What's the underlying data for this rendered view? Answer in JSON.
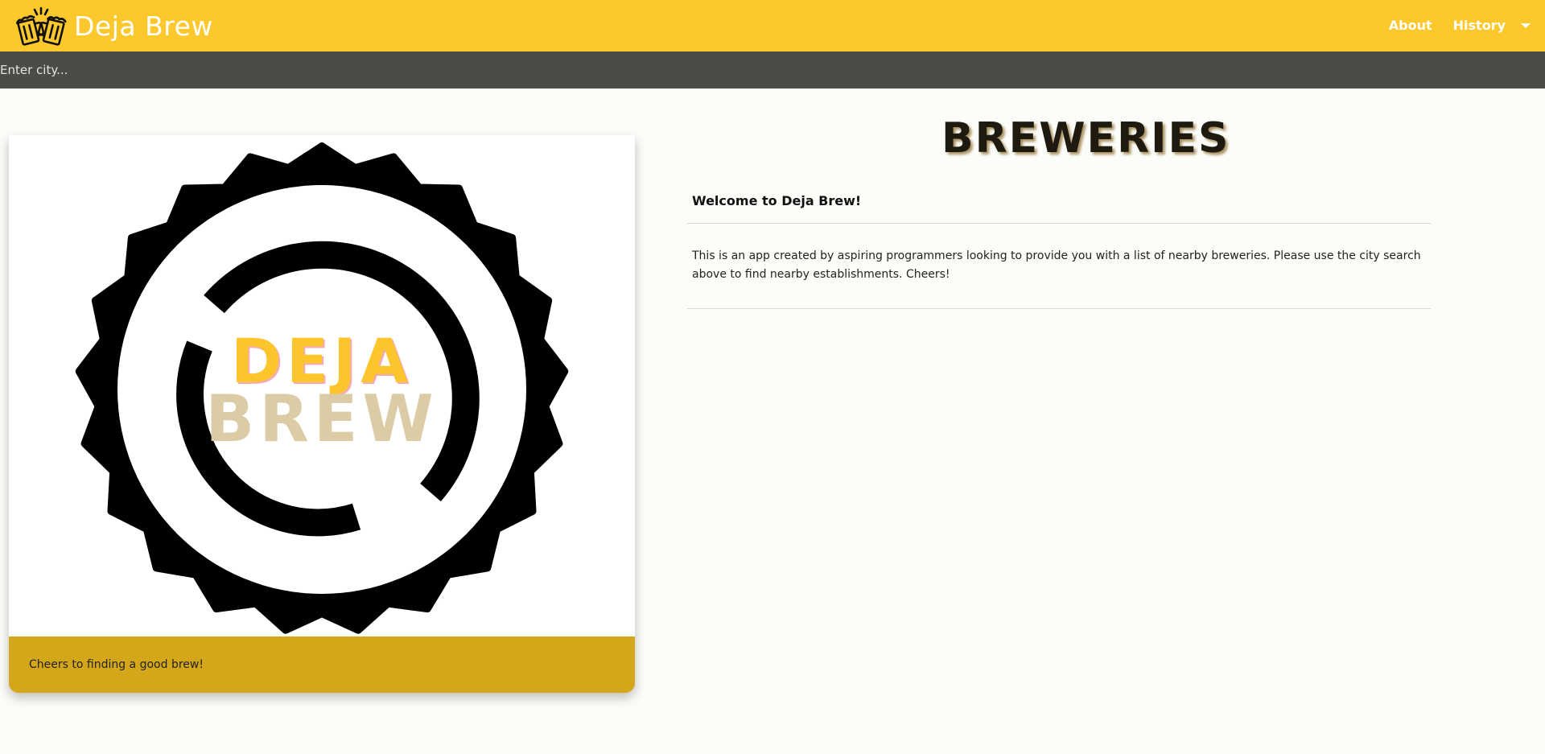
{
  "navbar": {
    "brand": "Deja Brew",
    "links": {
      "about": "About",
      "history": "History"
    },
    "colors": {
      "background": "#fdc82b",
      "text": "#ffffff"
    }
  },
  "search": {
    "placeholder": "Enter city...",
    "value": ""
  },
  "card": {
    "logo_text_top": "DEJA",
    "logo_text_bottom": "BREW",
    "caption": "Cheers to finding a good brew!",
    "footer_color": "#d4a71b"
  },
  "main": {
    "title": "BREWERIES",
    "welcome": "Welcome to Deja Brew!",
    "intro": "This is an app created by aspiring programmers looking to provide you with a list of nearby breweries. Please use the city search above to find nearby establishments. Cheers!"
  },
  "icons": {
    "brand": "beer-mugs-cheers-icon",
    "dropdown": "caret-down-icon",
    "card_logo": "bottle-cap-logo"
  }
}
